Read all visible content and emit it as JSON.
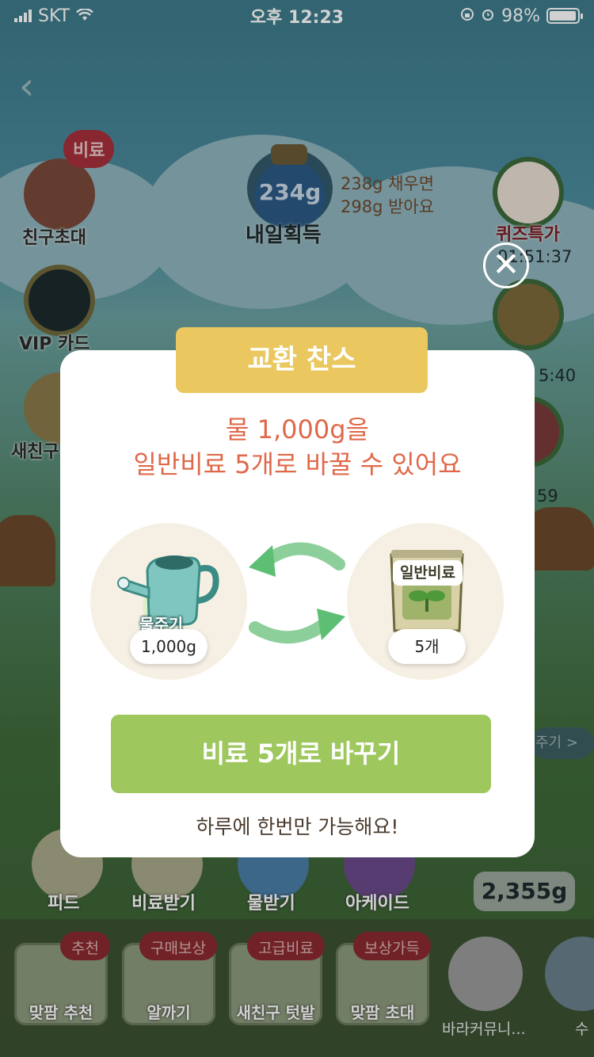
{
  "status_bar": {
    "carrier": "SKT",
    "time": "오후 12:23",
    "battery": "98%",
    "battery_level": 0.98
  },
  "left_menu": {
    "invite_tag": "비료",
    "invite": "친구초대",
    "vip": "VIP 카드",
    "new_friend": "새친구"
  },
  "jar": {
    "amount": "234g",
    "label": "내일획득",
    "note_line1": "238g 채우면",
    "note_line2": "298g 받아요"
  },
  "right_menu": {
    "quiz": "퀴즈특가",
    "timer1": "01:51:37",
    "timer2": "5:40",
    "timer3": "59",
    "more": "주기 >"
  },
  "bottom_row": {
    "feed": "피드",
    "fertilizer": "비료받기",
    "water": "물받기",
    "arcade": "아케이드",
    "water_amount": "2,355g"
  },
  "bottom_bar": {
    "items": [
      {
        "tag": "추천",
        "label": "맞팜 추천"
      },
      {
        "tag": "구매보상",
        "label": "알까기"
      },
      {
        "tag": "고급비료",
        "label": "새친구 텃밭"
      },
      {
        "tag": "보상가득",
        "label": "맞팜 초대"
      }
    ],
    "community": "바라커뮤니...",
    "last": "수"
  },
  "modal": {
    "title": "교환 찬스",
    "message_line1": "물 1,000g을",
    "message_line2": "일반비료 5개로 바꿀 수 있어요",
    "from_label": "물주기",
    "from_amount": "1,000g",
    "to_label": "일반비료",
    "to_amount": "5개",
    "button": "비료 5개로 바꾸기",
    "note": "하루에 한번만 가능해요!",
    "close": "✕"
  }
}
